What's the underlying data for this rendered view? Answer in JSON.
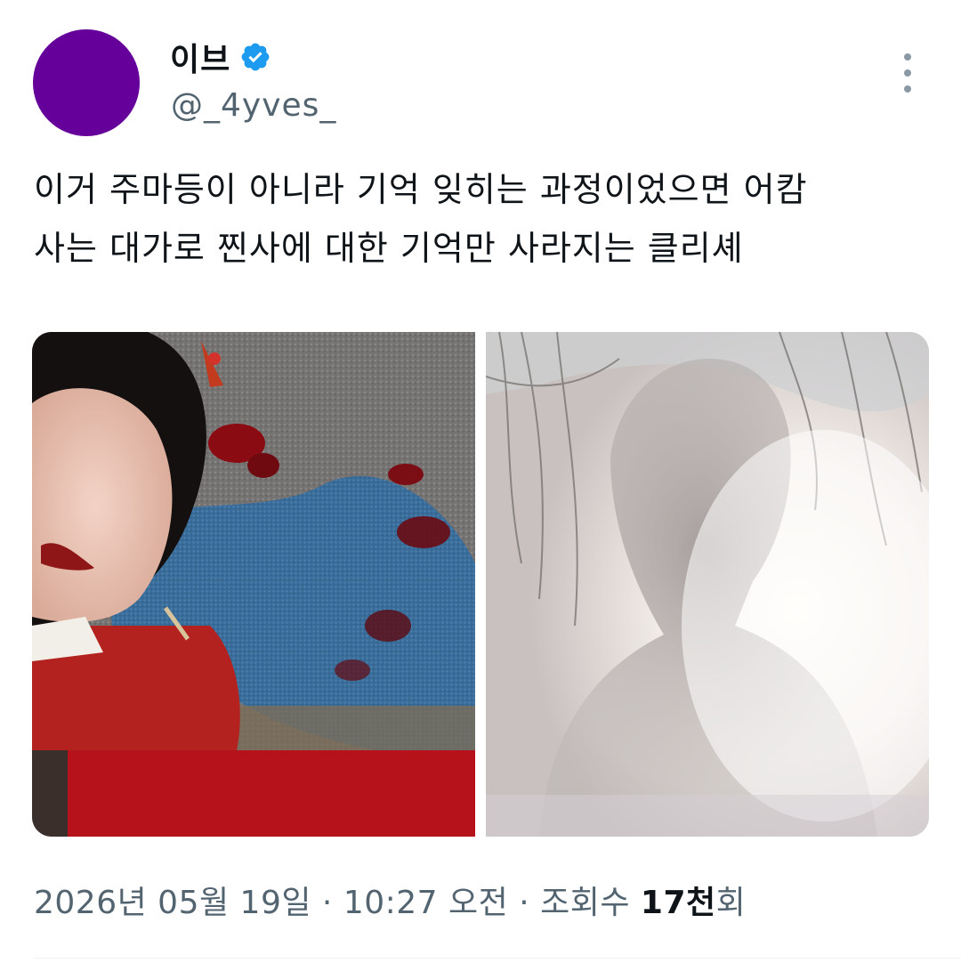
{
  "author": {
    "display_name": "이브",
    "handle": "@_4yves_",
    "verified": true,
    "avatar_color": "#66009a",
    "badge_color": "#1d9bf0"
  },
  "tweet": {
    "text_line1": "이거 주마등이 아니라 기억 잊히는 과정이었으면 어캄",
    "text_line2": "사는 대가로 찐사에 대한 기억만 사라지는 클리셰"
  },
  "meta": {
    "date": "2026년 05월 19일",
    "separator1": " · ",
    "time": "10:27 오전",
    "separator2": " · ",
    "views_label": "조회수 ",
    "views_count": "17천",
    "views_suffix": "회"
  },
  "icons": {
    "more": "more-vertical-icon",
    "verified": "verified-badge-icon"
  }
}
